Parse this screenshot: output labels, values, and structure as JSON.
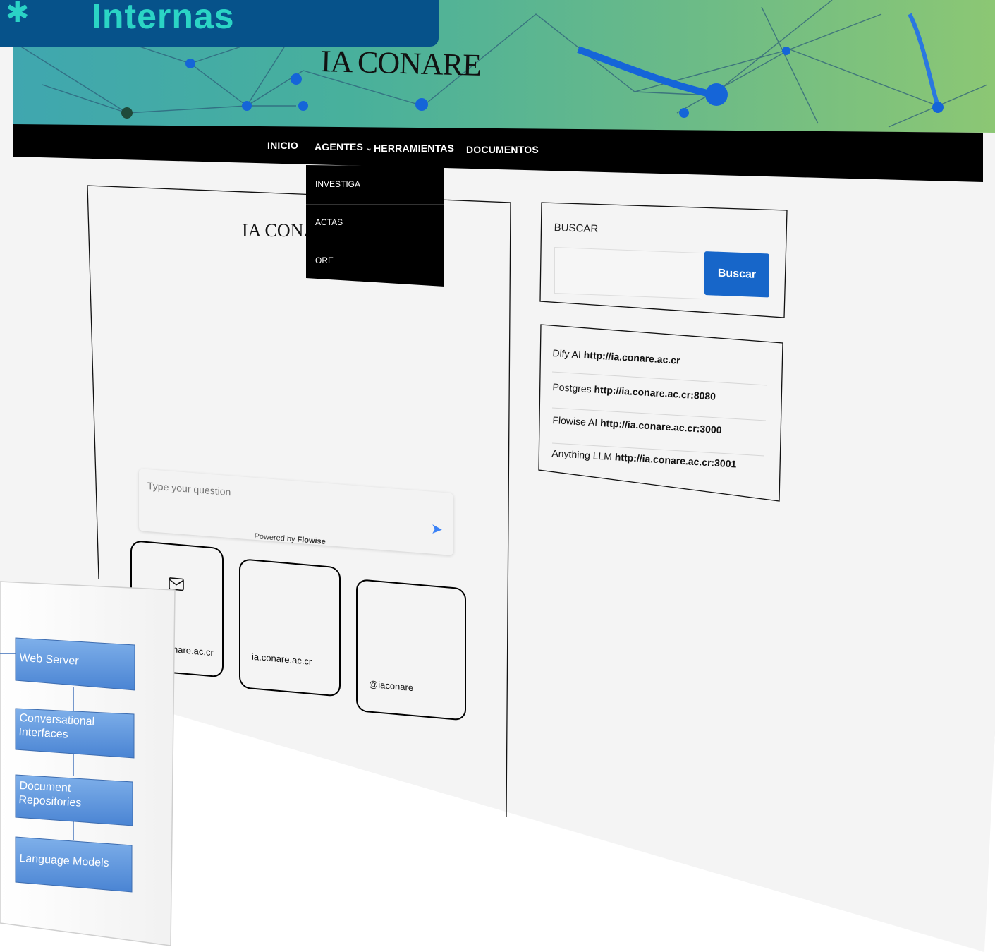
{
  "header_badge": {
    "title": "Internas",
    "icon": "gear-icon"
  },
  "site": {
    "title": "IA CONARE",
    "nav": {
      "items": [
        "INICIO",
        "AGENTES",
        "HERRAMIENTAS",
        "DOCUMENTOS"
      ],
      "dropdown_items": [
        "INVESTIGA",
        "ACTAS",
        "ORE"
      ]
    },
    "chat": {
      "title": "IA CONA",
      "placeholder": "Type your question",
      "powered_by": "Powered by",
      "powered_brand": "Flowise",
      "send_icon": "send-arrow-icon"
    },
    "social": [
      {
        "icon": "mail-icon",
        "text": "nare.ac.cr"
      },
      {
        "text": "ia.conare.ac.cr"
      },
      {
        "text": "@iaconare"
      }
    ],
    "search": {
      "label": "BUSCAR",
      "button": "Buscar",
      "value": ""
    },
    "links": [
      {
        "name": "Dify AI",
        "url": "http://ia.conare.ac.cr"
      },
      {
        "name": "Postgres",
        "url": "http://ia.conare.ac.cr:8080"
      },
      {
        "name": "Flowise AI",
        "url": "http://ia.conare.ac.cr:3000"
      },
      {
        "name": "Anything LLM",
        "url": "http://ia.conare.ac.cr:3001"
      }
    ]
  },
  "diagram": {
    "boxes": [
      "Web Server",
      "Conversational Interfaces",
      "Document Repositories",
      "Language Models"
    ]
  },
  "colors": {
    "badge_bg": "#06528a",
    "badge_text": "#2bd4c5",
    "nav_bg": "#000000",
    "search_button": "#1766c9",
    "diagram_box": "#5b95de"
  }
}
